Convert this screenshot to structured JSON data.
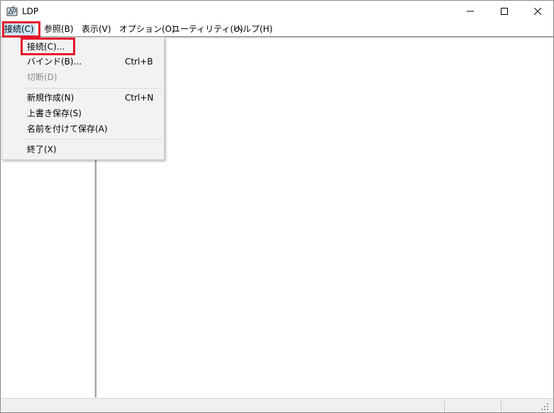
{
  "window": {
    "title": "LDP",
    "app_icon": "ldp-app-icon",
    "controls": [
      "minimize-icon",
      "maximize-icon",
      "close-icon"
    ]
  },
  "menubar": {
    "items": [
      {
        "label": "接続(C)"
      },
      {
        "label": "参照(B)"
      },
      {
        "label": "表示(V)"
      },
      {
        "label": "オプション(O)"
      },
      {
        "label": "ユーティリティ(U)"
      },
      {
        "label": "ヘルプ(H)"
      }
    ]
  },
  "dropdown": {
    "items": [
      {
        "label": "接続(C)...",
        "shortcut": ""
      },
      {
        "label": "バインド(B)...",
        "shortcut": "Ctrl+B"
      },
      {
        "label": "切断(D)",
        "shortcut": "",
        "disabled": true
      },
      {
        "label": "新規作成(N)",
        "shortcut": "Ctrl+N"
      },
      {
        "label": "上書き保存(S)",
        "shortcut": ""
      },
      {
        "label": "名前を付けて保存(A)",
        "shortcut": ""
      },
      {
        "label": "終了(X)",
        "shortcut": ""
      }
    ]
  },
  "colors": {
    "highlight": "#e5162b",
    "menu_active": "#cce8ff",
    "menu_bg": "#f2f2f2"
  }
}
